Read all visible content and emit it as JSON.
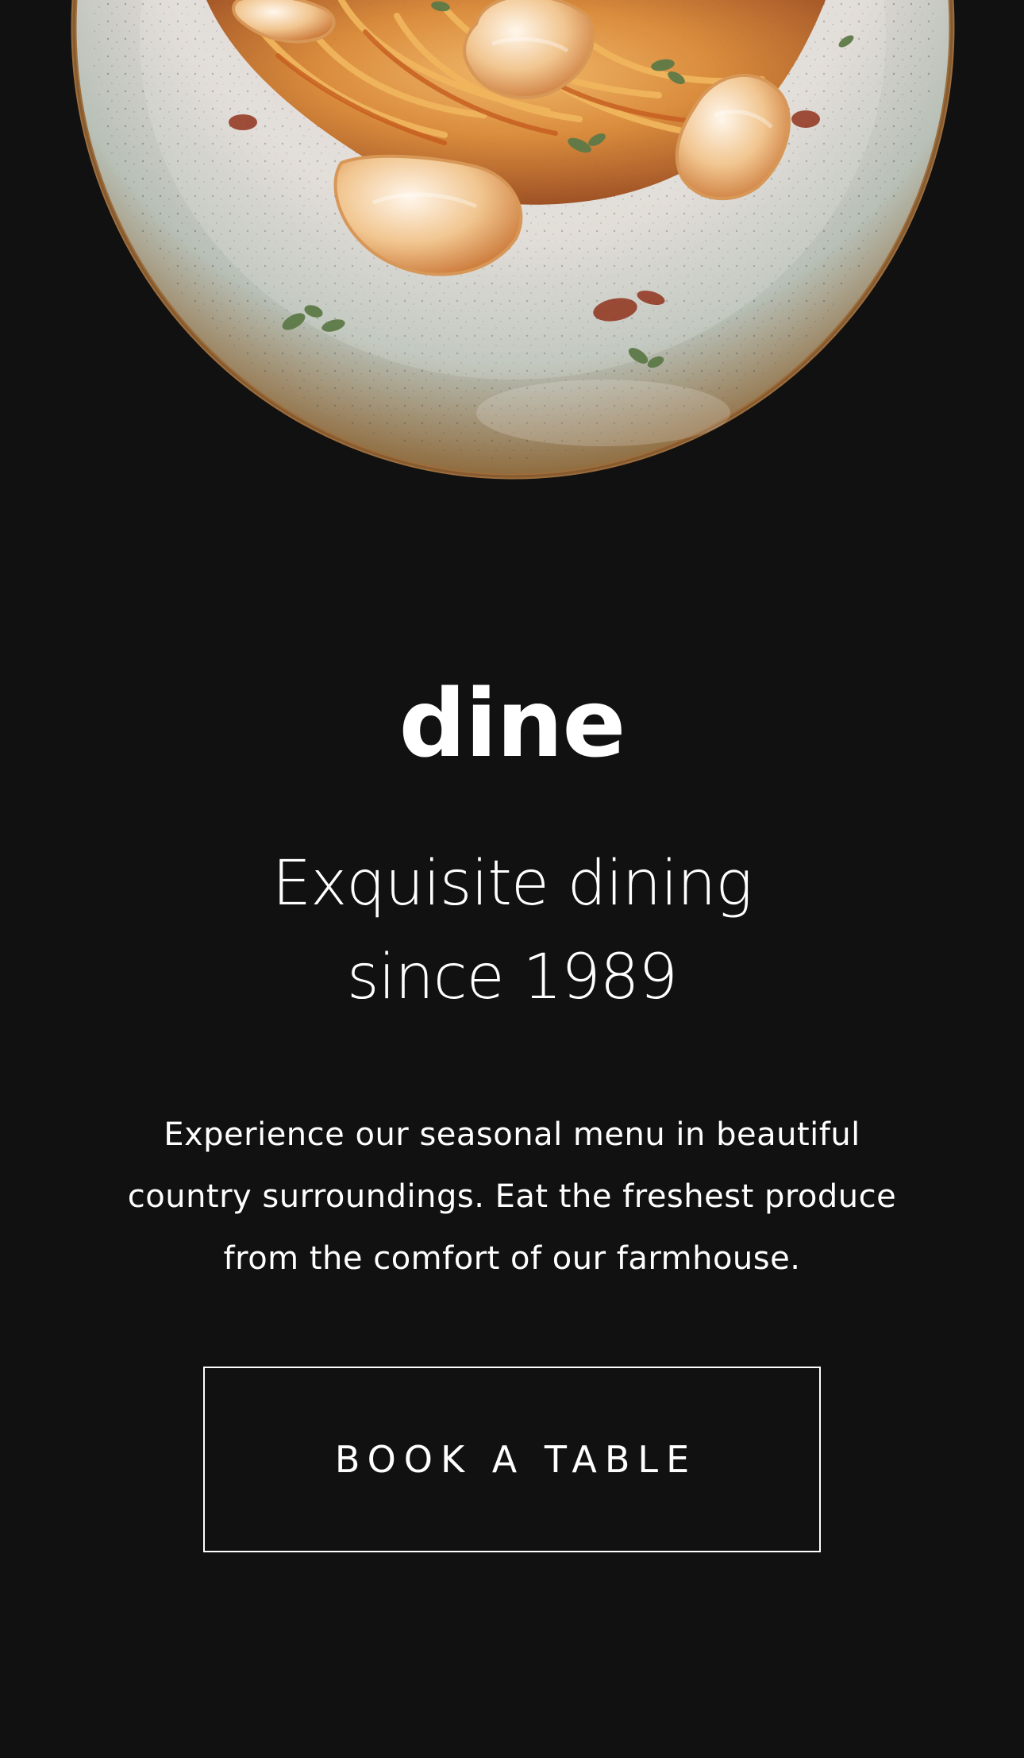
{
  "hero": {
    "image": "seafood-pasta-plate",
    "background_color": "#111111",
    "accent_color": "#ffffff"
  },
  "brand": {
    "name": "dine"
  },
  "headline": {
    "line1": "Exquisite dining",
    "line2": "since 1989"
  },
  "description": {
    "line1": "Experience our seasonal menu in beautiful",
    "line2": "country surroundings. Eat the freshest produce",
    "line3": "from the comfort of our farmhouse."
  },
  "cta": {
    "label": "BOOK A TABLE"
  }
}
